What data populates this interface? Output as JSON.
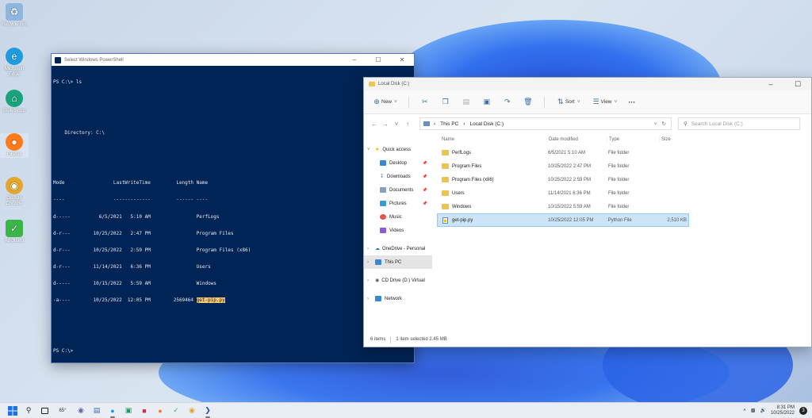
{
  "desktop": {
    "icons": [
      {
        "label": "Recycle Bin",
        "glyph": "♻",
        "color": "#8fb6de"
      },
      {
        "label": "Microsoft Edge",
        "glyph": "e",
        "color": "#1f9be0"
      },
      {
        "label": "Bulletscup",
        "glyph": "⌂",
        "color": "#1aa37a"
      },
      {
        "label": "Firefox",
        "glyph": "●",
        "color": "#ff7a1a"
      },
      {
        "label": "Google Chrome",
        "glyph": "◉",
        "color": "#e5a72b"
      },
      {
        "label": "AdGuard",
        "glyph": "✓",
        "color": "#3bb54a"
      }
    ]
  },
  "powershell": {
    "title": "Select Windows PowerShell",
    "lines": [
      "PS C:\\> ls",
      "",
      "",
      "    Directory: C:\\",
      "",
      "",
      "Mode                 LastWriteTime         Length Name",
      "----                 -------------         ------ ----",
      "d-----          6/5/2021   5:10 AM                PerfLogs",
      "d-r---        10/25/2022   2:47 PM                Program Files",
      "d-r---        10/25/2022   2:59 PM                Program Files (x86)",
      "d-r---        11/14/2021   6:36 PM                Users",
      "d-----        10/15/2022   5:59 AM                Windows",
      "-a----        10/25/2022  12:05 PM        2569464 ",
      "",
      "",
      "PS C:\\>"
    ],
    "highlighted_file": "get-pip.py"
  },
  "explorer": {
    "title": "Local Disk (C:)",
    "toolbar": {
      "new_label": "New",
      "sort_label": "Sort",
      "view_label": "View",
      "more_label": "···"
    },
    "address": {
      "segments": [
        "This PC",
        "Local Disk (C:)"
      ],
      "search_placeholder": "Search Local Disk (C:)"
    },
    "nav": {
      "quick_access": "Quick access",
      "pinned": [
        "Desktop",
        "Downloads",
        "Documents",
        "Pictures"
      ],
      "other": [
        "Music",
        "Videos"
      ],
      "onedrive": "OneDrive - Personal",
      "this_pc": "This PC",
      "cd_drive": "CD Drive (D:) Virtual",
      "network": "Network"
    },
    "columns": {
      "name": "Name",
      "date": "Date modified",
      "type": "Type",
      "size": "Size"
    },
    "files": [
      {
        "name": "PerfLogs",
        "date": "6/5/2021 5:10 AM",
        "type": "File folder",
        "size": ""
      },
      {
        "name": "Program Files",
        "date": "10/25/2022 2:47 PM",
        "type": "File folder",
        "size": ""
      },
      {
        "name": "Program Files (x86)",
        "date": "10/25/2022 2:59 PM",
        "type": "File folder",
        "size": ""
      },
      {
        "name": "Users",
        "date": "11/14/2021 6:36 PM",
        "type": "File folder",
        "size": ""
      },
      {
        "name": "Windows",
        "date": "10/15/2022 5:59 AM",
        "type": "File folder",
        "size": ""
      },
      {
        "name": "get-pip.py",
        "date": "10/25/2022 12:05 PM",
        "type": "Python File",
        "size": "2,510 KB"
      }
    ],
    "status": {
      "items": "6 items",
      "selected": "1 item selected  2.45 MB"
    }
  },
  "taskbar": {
    "weather": "65°",
    "time": "8:31 PM",
    "date": "10/25/2022",
    "notif": "3"
  }
}
